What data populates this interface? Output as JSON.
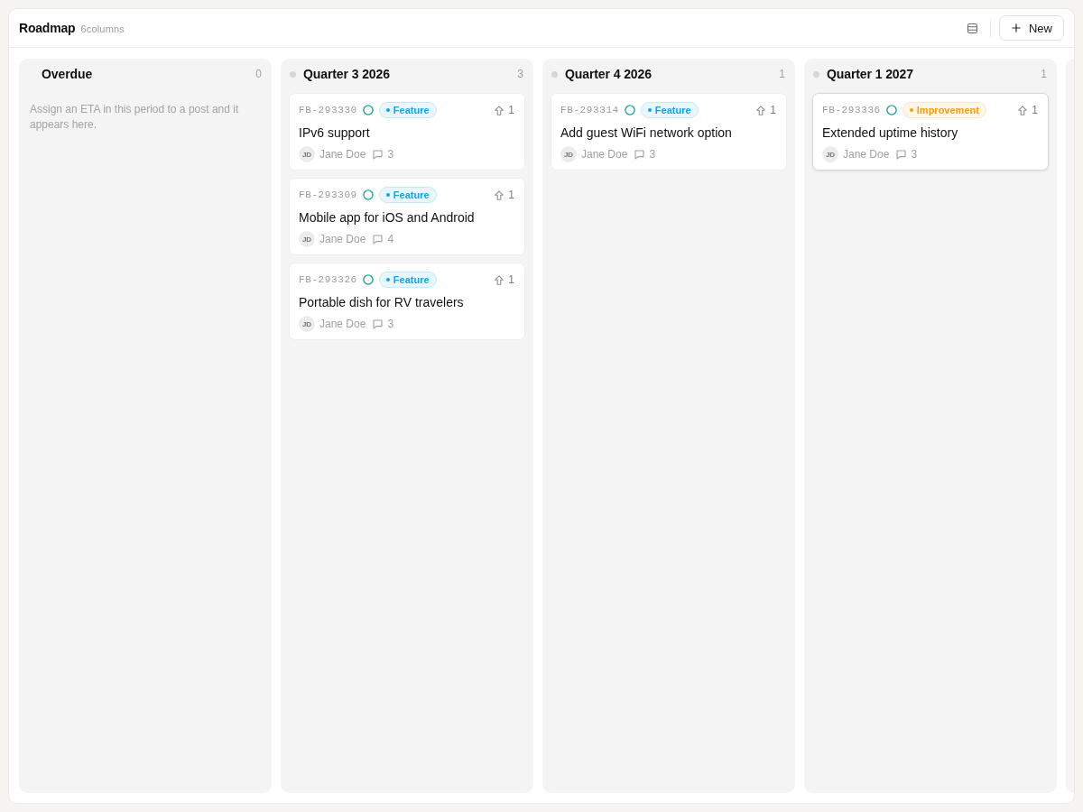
{
  "header": {
    "title": "Roadmap",
    "subtitle": "6columns",
    "new_button": "New"
  },
  "columns": [
    {
      "title": "Overdue",
      "dot": false,
      "count": "0",
      "empty_message": "Assign an ETA in this period to a post and it appears here."
    },
    {
      "title": "Quarter 3 2026",
      "dot": true,
      "count": "3",
      "cards": [
        {
          "id": "FB-293330",
          "tag": {
            "label": "Feature",
            "color": "#0ea5e9"
          },
          "votes": "1",
          "title": "IPv6 support",
          "author": {
            "initials": "JD",
            "name": "Jane Doe"
          },
          "comments": "3",
          "highlighted": false
        },
        {
          "id": "FB-293309",
          "tag": {
            "label": "Feature",
            "color": "#0ea5e9"
          },
          "votes": "1",
          "title": "Mobile app for iOS and Android",
          "author": {
            "initials": "JD",
            "name": "Jane Doe"
          },
          "comments": "4",
          "highlighted": false
        },
        {
          "id": "FB-293326",
          "tag": {
            "label": "Feature",
            "color": "#0ea5e9"
          },
          "votes": "1",
          "title": "Portable dish for RV travelers",
          "author": {
            "initials": "JD",
            "name": "Jane Doe"
          },
          "comments": "3",
          "highlighted": false
        }
      ]
    },
    {
      "title": "Quarter 4 2026",
      "dot": true,
      "count": "1",
      "cards": [
        {
          "id": "FB-293314",
          "tag": {
            "label": "Feature",
            "color": "#0ea5e9"
          },
          "votes": "1",
          "title": "Add guest WiFi network option",
          "author": {
            "initials": "JD",
            "name": "Jane Doe"
          },
          "comments": "3",
          "highlighted": false
        }
      ]
    },
    {
      "title": "Quarter 1 2027",
      "dot": true,
      "count": "1",
      "cards": [
        {
          "id": "FB-293336",
          "tag": {
            "label": "Improvement",
            "color": "#f59e0b"
          },
          "votes": "1",
          "title": "Extended uptime history",
          "author": {
            "initials": "JD",
            "name": "Jane Doe"
          },
          "comments": "3",
          "highlighted": true
        }
      ]
    }
  ],
  "clipped_column": true
}
